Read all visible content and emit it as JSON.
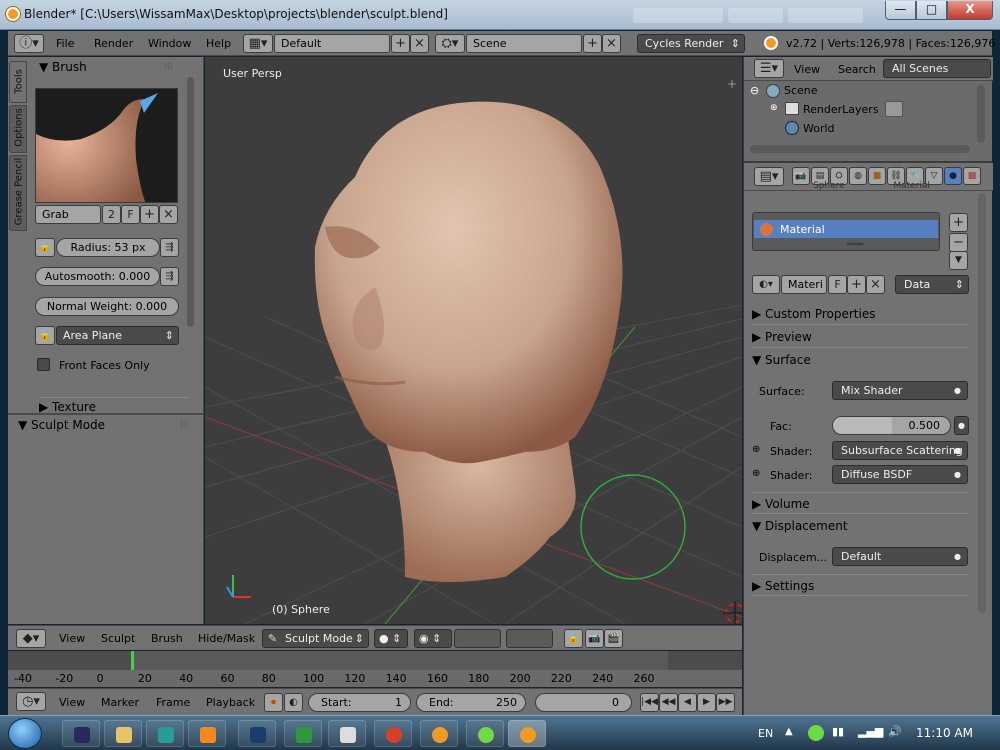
{
  "window": {
    "title": "Blender* [C:\\Users\\WissamMax\\Desktop\\projects\\blender\\sculpt.blend]",
    "minimize": "—",
    "maximize": "□",
    "close": "X"
  },
  "menus": {
    "file": "File",
    "render": "Render",
    "window": "Window",
    "help": "Help"
  },
  "layout": {
    "screen": "Default",
    "scene": "Scene",
    "engine": "Cycles Render"
  },
  "stats": "v2.72 | Verts:126,978 | Faces:126,976 |",
  "tool_tabs": [
    "Tools",
    "Options",
    "Grease Pencil"
  ],
  "brush": {
    "header": "Brush",
    "name": "Grab",
    "users": "2",
    "fake_user": "F",
    "radius_label": "Radius:",
    "radius_value": "53 px",
    "autosmooth": "Autosmooth: 0.000",
    "normal_weight": "Normal Weight:  0.000",
    "plane": "Area Plane",
    "front_faces": "Front Faces Only"
  },
  "texture": {
    "header": "Texture"
  },
  "sculpt_mode": {
    "header": "Sculpt Mode"
  },
  "viewport": {
    "label": "User Persp",
    "object": "(0) Sphere"
  },
  "viewport_bar": {
    "view": "View",
    "sculpt": "Sculpt",
    "brush": "Brush",
    "hide_mask": "Hide/Mask",
    "mode": "Sculpt Mode"
  },
  "timeline": {
    "ticks": [
      "-40",
      "-20",
      "0",
      "20",
      "40",
      "60",
      "80",
      "100",
      "120",
      "140",
      "160",
      "180",
      "200",
      "220",
      "240",
      "260"
    ],
    "current_frame": 0,
    "view": "View",
    "marker": "Marker",
    "frame": "Frame",
    "playback": "Playback",
    "start_label": "Start:",
    "start": "1",
    "end_label": "End:",
    "end": "250",
    "current": "0"
  },
  "outliner": {
    "view": "View",
    "search": "Search",
    "filter": "All Scenes",
    "items": [
      "Scene",
      "RenderLayers",
      "World"
    ]
  },
  "material": {
    "breadcrumbs": [
      "Sphere",
      "Material"
    ],
    "slot": "Material",
    "datablock": "Materi",
    "fake_user": "F",
    "link": "Data"
  },
  "panels": {
    "custom_props": "Custom Properties",
    "preview": "Preview",
    "surface": "Surface",
    "surface_label": "Surface:",
    "surface_value": "Mix Shader",
    "fac_label": "Fac:",
    "fac_value": "0.500",
    "fac_fraction": 0.5,
    "shader1_label": "Shader:",
    "shader1_value": "Subsurface Scattering",
    "shader2_label": "Shader:",
    "shader2_value": "Diffuse BSDF",
    "volume": "Volume",
    "displacement": "Displacement",
    "displacement_label": "Displacem...",
    "displacement_value": "Default",
    "settings": "Settings"
  },
  "taskbar": {
    "lang": "EN",
    "time": "11:10 AM"
  },
  "colors": {
    "blender_orange": "#f29b24",
    "selection_blue": "#5680c2",
    "ui_gray": "#727272",
    "viewport_bg": "#3d3d3d",
    "skin": "#c9a58e"
  }
}
